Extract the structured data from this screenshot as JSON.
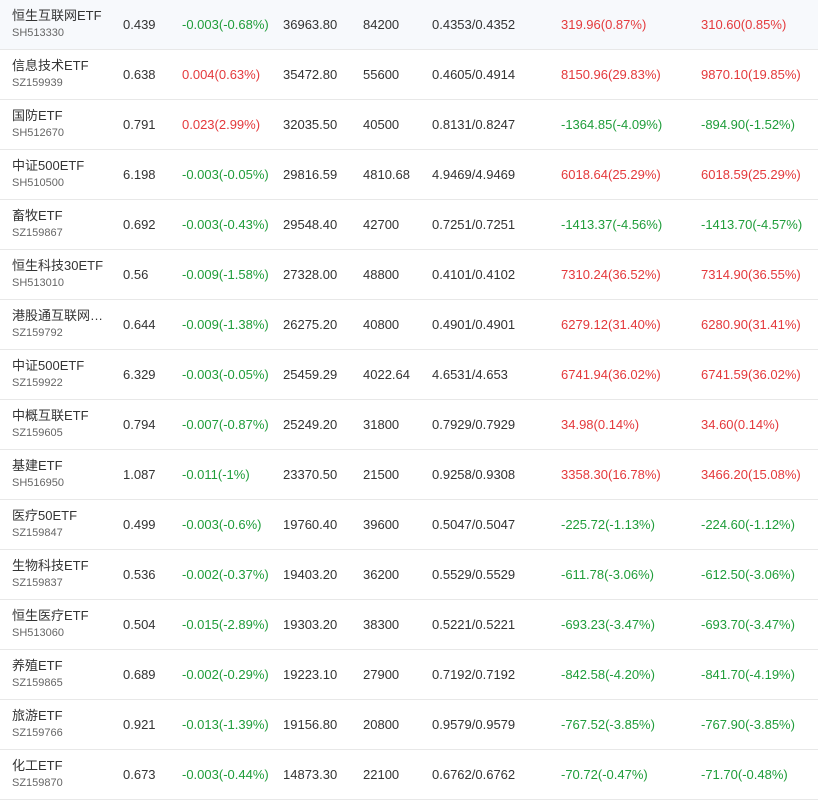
{
  "colors": {
    "up": "#e4393c",
    "down": "#1f9d3a",
    "text": "#333333",
    "code": "#666666",
    "divider": "#e8e8e8"
  },
  "rows": [
    {
      "name": "恒生互联网ETF",
      "code": "SH513330",
      "price": "0.439",
      "change": "-0.003(-0.68%)",
      "change_dir": "down",
      "amount": "36963.80",
      "volume": "84200",
      "bid_ask": "0.4353/0.4352",
      "flow1": "319.96(0.87%)",
      "flow1_dir": "up",
      "flow2": "310.60(0.85%)",
      "flow2_dir": "up"
    },
    {
      "name": "信息技术ETF",
      "code": "SZ159939",
      "price": "0.638",
      "change": "0.004(0.63%)",
      "change_dir": "up",
      "amount": "35472.80",
      "volume": "55600",
      "bid_ask": "0.4605/0.4914",
      "flow1": "8150.96(29.83%)",
      "flow1_dir": "up",
      "flow2": "9870.10(19.85%)",
      "flow2_dir": "up"
    },
    {
      "name": "国防ETF",
      "code": "SH512670",
      "price": "0.791",
      "change": "0.023(2.99%)",
      "change_dir": "up",
      "amount": "32035.50",
      "volume": "40500",
      "bid_ask": "0.8131/0.8247",
      "flow1": "-1364.85(-4.09%)",
      "flow1_dir": "down",
      "flow2": "-894.90(-1.52%)",
      "flow2_dir": "down"
    },
    {
      "name": "中证500ETF",
      "code": "SH510500",
      "price": "6.198",
      "change": "-0.003(-0.05%)",
      "change_dir": "down",
      "amount": "29816.59",
      "volume": "4810.68",
      "bid_ask": "4.9469/4.9469",
      "flow1": "6018.64(25.29%)",
      "flow1_dir": "up",
      "flow2": "6018.59(25.29%)",
      "flow2_dir": "up"
    },
    {
      "name": "畜牧ETF",
      "code": "SZ159867",
      "price": "0.692",
      "change": "-0.003(-0.43%)",
      "change_dir": "down",
      "amount": "29548.40",
      "volume": "42700",
      "bid_ask": "0.7251/0.7251",
      "flow1": "-1413.37(-4.56%)",
      "flow1_dir": "down",
      "flow2": "-1413.70(-4.57%)",
      "flow2_dir": "down"
    },
    {
      "name": "恒生科技30ETF",
      "code": "SH513010",
      "price": "0.56",
      "change": "-0.009(-1.58%)",
      "change_dir": "down",
      "amount": "27328.00",
      "volume": "48800",
      "bid_ask": "0.4101/0.4102",
      "flow1": "7310.24(36.52%)",
      "flow1_dir": "up",
      "flow2": "7314.90(36.55%)",
      "flow2_dir": "up"
    },
    {
      "name": "港股通互联网…",
      "code": "SZ159792",
      "price": "0.644",
      "change": "-0.009(-1.38%)",
      "change_dir": "down",
      "amount": "26275.20",
      "volume": "40800",
      "bid_ask": "0.4901/0.4901",
      "flow1": "6279.12(31.40%)",
      "flow1_dir": "up",
      "flow2": "6280.90(31.41%)",
      "flow2_dir": "up"
    },
    {
      "name": "中证500ETF",
      "code": "SZ159922",
      "price": "6.329",
      "change": "-0.003(-0.05%)",
      "change_dir": "down",
      "amount": "25459.29",
      "volume": "4022.64",
      "bid_ask": "4.6531/4.653",
      "flow1": "6741.94(36.02%)",
      "flow1_dir": "up",
      "flow2": "6741.59(36.02%)",
      "flow2_dir": "up"
    },
    {
      "name": "中概互联ETF",
      "code": "SZ159605",
      "price": "0.794",
      "change": "-0.007(-0.87%)",
      "change_dir": "down",
      "amount": "25249.20",
      "volume": "31800",
      "bid_ask": "0.7929/0.7929",
      "flow1": "34.98(0.14%)",
      "flow1_dir": "up",
      "flow2": "34.60(0.14%)",
      "flow2_dir": "up"
    },
    {
      "name": "基建ETF",
      "code": "SH516950",
      "price": "1.087",
      "change": "-0.011(-1%)",
      "change_dir": "down",
      "amount": "23370.50",
      "volume": "21500",
      "bid_ask": "0.9258/0.9308",
      "flow1": "3358.30(16.78%)",
      "flow1_dir": "up",
      "flow2": "3466.20(15.08%)",
      "flow2_dir": "up"
    },
    {
      "name": "医疗50ETF",
      "code": "SZ159847",
      "price": "0.499",
      "change": "-0.003(-0.6%)",
      "change_dir": "down",
      "amount": "19760.40",
      "volume": "39600",
      "bid_ask": "0.5047/0.5047",
      "flow1": "-225.72(-1.13%)",
      "flow1_dir": "down",
      "flow2": "-224.60(-1.12%)",
      "flow2_dir": "down"
    },
    {
      "name": "生物科技ETF",
      "code": "SZ159837",
      "price": "0.536",
      "change": "-0.002(-0.37%)",
      "change_dir": "down",
      "amount": "19403.20",
      "volume": "36200",
      "bid_ask": "0.5529/0.5529",
      "flow1": "-611.78(-3.06%)",
      "flow1_dir": "down",
      "flow2": "-612.50(-3.06%)",
      "flow2_dir": "down"
    },
    {
      "name": "恒生医疗ETF",
      "code": "SH513060",
      "price": "0.504",
      "change": "-0.015(-2.89%)",
      "change_dir": "down",
      "amount": "19303.20",
      "volume": "38300",
      "bid_ask": "0.5221/0.5221",
      "flow1": "-693.23(-3.47%)",
      "flow1_dir": "down",
      "flow2": "-693.70(-3.47%)",
      "flow2_dir": "down"
    },
    {
      "name": "养殖ETF",
      "code": "SZ159865",
      "price": "0.689",
      "change": "-0.002(-0.29%)",
      "change_dir": "down",
      "amount": "19223.10",
      "volume": "27900",
      "bid_ask": "0.7192/0.7192",
      "flow1": "-842.58(-4.20%)",
      "flow1_dir": "down",
      "flow2": "-841.70(-4.19%)",
      "flow2_dir": "down"
    },
    {
      "name": "旅游ETF",
      "code": "SZ159766",
      "price": "0.921",
      "change": "-0.013(-1.39%)",
      "change_dir": "down",
      "amount": "19156.80",
      "volume": "20800",
      "bid_ask": "0.9579/0.9579",
      "flow1": "-767.52(-3.85%)",
      "flow1_dir": "down",
      "flow2": "-767.90(-3.85%)",
      "flow2_dir": "down"
    },
    {
      "name": "化工ETF",
      "code": "SZ159870",
      "price": "0.673",
      "change": "-0.003(-0.44%)",
      "change_dir": "down",
      "amount": "14873.30",
      "volume": "22100",
      "bid_ask": "0.6762/0.6762",
      "flow1": "-70.72(-0.47%)",
      "flow1_dir": "down",
      "flow2": "-71.70(-0.48%)",
      "flow2_dir": "down"
    }
  ]
}
